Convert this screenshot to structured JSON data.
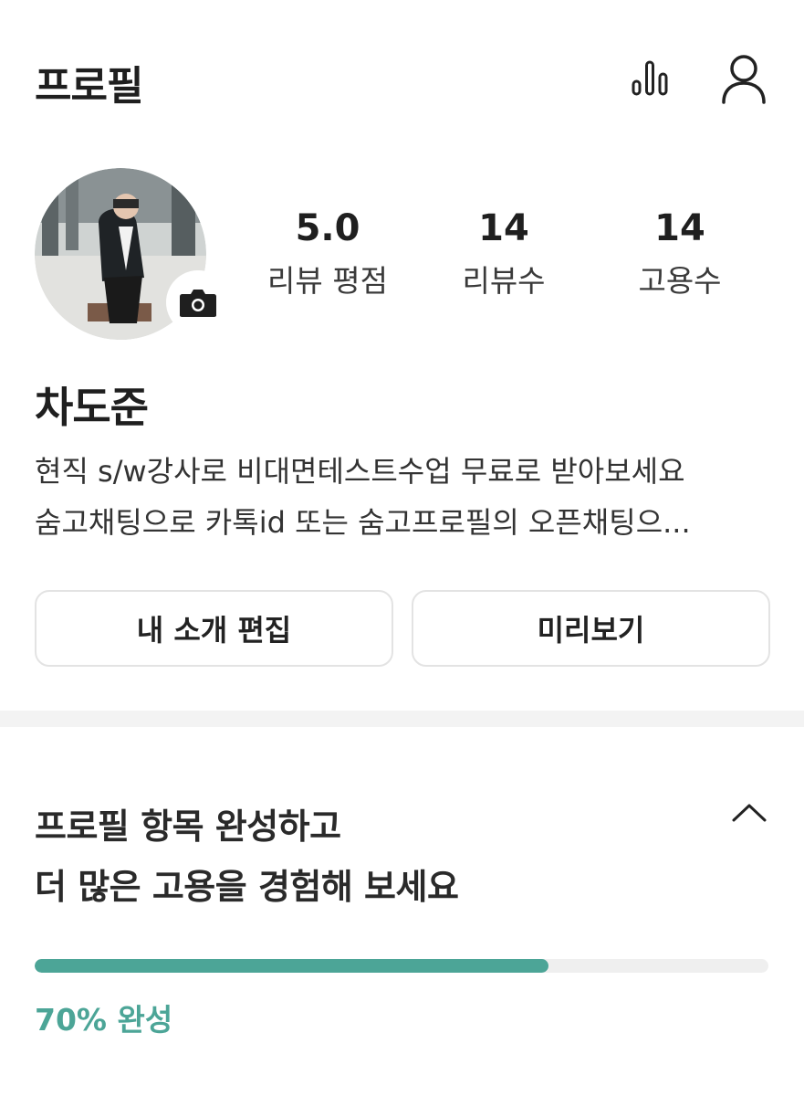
{
  "header": {
    "title": "프로필",
    "icons": [
      "bar-chart-icon",
      "user-account-icon"
    ]
  },
  "profile": {
    "name": "차도준",
    "avatar_badge_icon": "camera-icon",
    "stats": [
      {
        "value": "5.0",
        "label": "리뷰 평점"
      },
      {
        "value": "14",
        "label": "리뷰수"
      },
      {
        "value": "14",
        "label": "고용수"
      }
    ],
    "intro_lines": [
      "현직 s/w강사로 비대면테스트수업 무료로 받아보세요",
      "숨고채팅으로 카톡id 또는 숨고프로필의 오픈채팅으..."
    ]
  },
  "actions": {
    "edit_label": "내 소개 편집",
    "preview_label": "미리보기"
  },
  "completion": {
    "title_line1": "프로필 항목 완성하고",
    "title_line2": "더 많은 고용을 경험해 보세요",
    "progress_fraction": 0.7,
    "progress_text": "70% 완성",
    "collapse_icon": "chevron-up-icon"
  },
  "colors": {
    "accent": "#4ca597",
    "text": "#222222",
    "border": "#e3e3e3",
    "divider": "#f3f3f3"
  }
}
